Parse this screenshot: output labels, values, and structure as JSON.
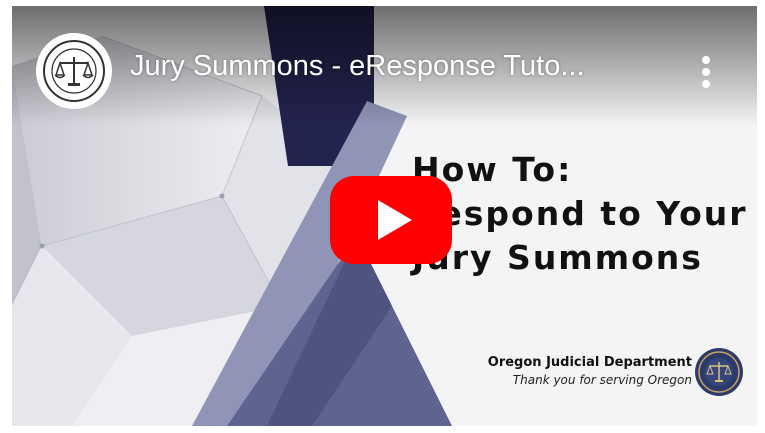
{
  "video": {
    "title": "Jury Summons - eResponse Tuto...",
    "channel_avatar_icon": "oregon-judicial-seal-icon",
    "more_icon": "more-vertical-icon",
    "play_icon": "youtube-play-icon"
  },
  "thumbnail": {
    "headline_lines": [
      "How To:",
      "Respond to Your",
      "Jury Summons"
    ],
    "organization": "Oregon Judicial Department",
    "tagline": "Thank you for serving Oregon"
  },
  "colors": {
    "play_red": "#ff0000",
    "navy": "#23234f",
    "slate": "#6a6f99",
    "title_text": "#ffffff"
  }
}
